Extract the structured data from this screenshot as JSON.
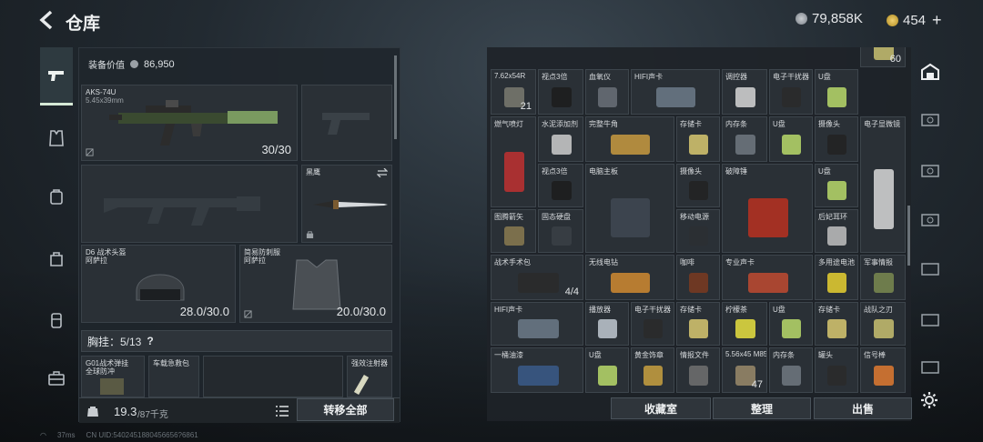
{
  "header": {
    "title": "仓库",
    "currency_silver": "79,858K",
    "currency_gold": "454"
  },
  "loadout": {
    "equip_value_label": "装备价值",
    "equip_value": "86,950",
    "primary": {
      "name": "AKS-74U",
      "caliber": "5.45x39mm",
      "durability": "30/30"
    },
    "melee": {
      "name": "黑鹰"
    },
    "helmet": {
      "name": "D6 战术头盔",
      "sub": "阿萨拉",
      "durability": "28.0/30.0"
    },
    "armor": {
      "name": "简易防刺服",
      "sub": "阿萨拉",
      "durability": "20.0/30.0"
    },
    "chest": {
      "label": "胸挂：5/13",
      "help": "?"
    },
    "chest_items": [
      "G01战术弹挂",
      "全球防冲",
      "车载急救包",
      "强效注射器"
    ],
    "weight": "19.3",
    "weight_max": "/87千克",
    "transfer_all": "转移全部"
  },
  "inventory": {
    "items": [
      {
        "name": "7.62x54R",
        "qty": "21",
        "color": "#7a7a70"
      },
      {
        "name": "视点3倍",
        "qty": "",
        "color": "#1c1c1c"
      },
      {
        "name": "血氧仪",
        "qty": "",
        "color": "#6a7078"
      },
      {
        "name": "HIFI声卡",
        "qty": "",
        "color": "#6c7a88"
      },
      {
        "name": "调控器",
        "qty": "",
        "color": "#d6d6d6"
      },
      {
        "name": "电子干扰器",
        "qty": "",
        "color": "#2a2a2a"
      },
      {
        "name": "U盘",
        "qty": "",
        "color": "#b8d96a"
      },
      {
        "name": "战队之刃",
        "qty": "60",
        "color": "#c8c070"
      },
      {
        "name": "燃气喷灯",
        "qty": "",
        "color": "#c03030"
      },
      {
        "name": "水泥添加剂",
        "qty": "",
        "color": "#cccccc"
      },
      {
        "name": "完整牛角",
        "qty": "",
        "color": "#c89a40"
      },
      {
        "name": "存储卡",
        "qty": "",
        "color": "#d8c870"
      },
      {
        "name": "内存条",
        "qty": "",
        "color": "#707880"
      },
      {
        "name": "U盘",
        "qty": "",
        "color": "#b8d96a"
      },
      {
        "name": "摄像头",
        "qty": "",
        "color": "#222222"
      },
      {
        "name": "电子显微镜",
        "qty": "",
        "color": "#d8d8d8"
      },
      {
        "name": "视点3倍",
        "qty": "",
        "color": "#1c1c1c"
      },
      {
        "name": "电脑主板",
        "qty": "",
        "color": "#404852"
      },
      {
        "name": "摄像头",
        "qty": "",
        "color": "#222222"
      },
      {
        "name": "破障锤",
        "qty": "",
        "color": "#b83020"
      },
      {
        "name": "U盘",
        "qty": "",
        "color": "#b8d96a"
      },
      {
        "name": "图腾箭矢",
        "qty": "",
        "color": "#8a7a50"
      },
      {
        "name": "固态硬盘",
        "qty": "",
        "color": "#3a3f45"
      },
      {
        "name": "移动电源",
        "qty": "",
        "color": "#2b2f33"
      },
      {
        "name": "后妃耳环",
        "qty": "",
        "color": "#c0c0c0"
      },
      {
        "name": "战术手术包",
        "qty": "4/4",
        "color": "#2a2a2a"
      },
      {
        "name": "无线电钻",
        "qty": "",
        "color": "#d08a30"
      },
      {
        "name": "咖啡",
        "qty": "",
        "color": "#7a3a20"
      },
      {
        "name": "专业声卡",
        "qty": "",
        "color": "#c04a30"
      },
      {
        "name": "多用途电池",
        "qty": "",
        "color": "#e8d030"
      },
      {
        "name": "军事情报",
        "qty": "",
        "color": "#7a8a50"
      },
      {
        "name": "HIFI声卡",
        "qty": "",
        "color": "#6c7a88"
      },
      {
        "name": "播放器",
        "qty": "",
        "color": "#c0c8d0"
      },
      {
        "name": "电子干扰器",
        "qty": "",
        "color": "#2a2a2a"
      },
      {
        "name": "存储卡",
        "qty": "",
        "color": "#d8c870"
      },
      {
        "name": "柠檬茶",
        "qty": "",
        "color": "#e8e040"
      },
      {
        "name": "U盘",
        "qty": "",
        "color": "#b8d96a"
      },
      {
        "name": "存储卡",
        "qty": "",
        "color": "#d8c870"
      },
      {
        "name": "战队之刃",
        "qty": "",
        "color": "#c8c070"
      },
      {
        "name": "一桶油漆",
        "qty": "",
        "color": "#3a5a8a"
      },
      {
        "name": "U盘",
        "qty": "",
        "color": "#b8d96a"
      },
      {
        "name": "黄金饰章",
        "qty": "",
        "color": "#c8a040"
      },
      {
        "name": "情报文件",
        "qty": "",
        "color": "#707070"
      },
      {
        "name": "5.56x45 M855A1",
        "qty": "47",
        "color": "#9a8a6a"
      },
      {
        "name": "内存条",
        "qty": "",
        "color": "#707880"
      },
      {
        "name": "罐头",
        "qty": "",
        "color": "#2a2a2a"
      },
      {
        "name": "信号棒",
        "qty": "",
        "color": "#e07a30"
      }
    ],
    "collection": "收藏室",
    "sort": "整理",
    "sell": "出售"
  },
  "footer": {
    "ping": "37ms",
    "uid": "CN UID:5402451880456656?6861"
  }
}
